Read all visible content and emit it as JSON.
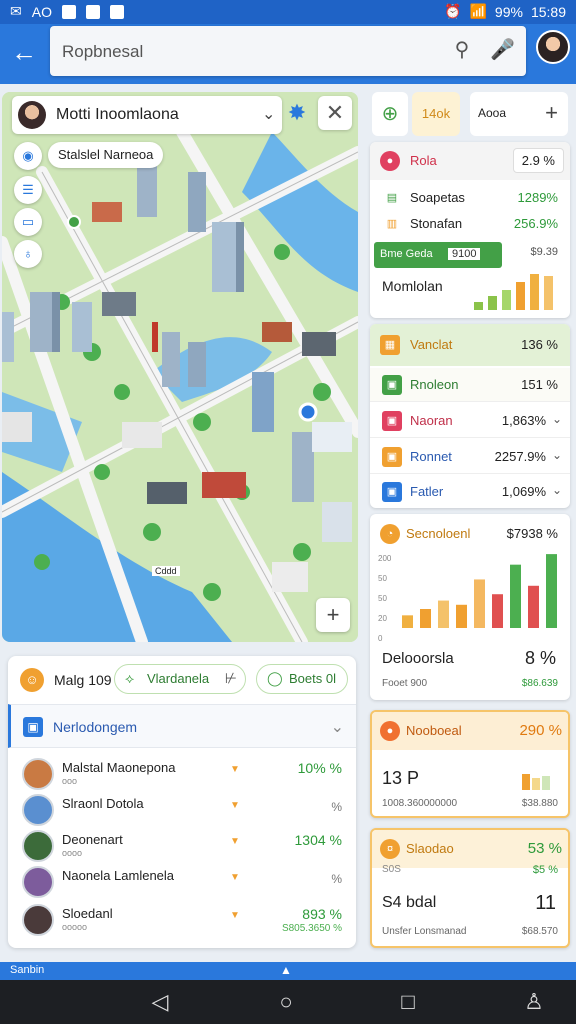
{
  "status": {
    "left_text": "AO",
    "time": "15:89",
    "battery": "99%"
  },
  "search": {
    "value": "Ropbnesal"
  },
  "map": {
    "title": "Motti Inoomlaona",
    "chip": "Stalslel Narneoa",
    "label": "Cddd"
  },
  "panel": {
    "title": "Malg 109",
    "pill1": "Vlardanela",
    "pill2": "Boets 0l",
    "section": "Nerlodongem",
    "rows": [
      {
        "name": "Malstal Maonepona",
        "sub": "ooo",
        "value": "10% %",
        "value2": "",
        "color": "#c97a43"
      },
      {
        "name": "Slraonl Dotola",
        "sub": "",
        "value": "%",
        "value2": "",
        "color": "#5a8fd0"
      },
      {
        "name": "Deonenart",
        "sub": "oooo",
        "value": "1304 %",
        "value2": "",
        "color": "#3c6b3a"
      },
      {
        "name": "Naonela Lamlenela",
        "sub": "",
        "value": "%",
        "value2": "",
        "color": "#7d5c9c"
      },
      {
        "name": "Sloedanl",
        "sub": "ooooo",
        "value": "893 %",
        "value2": "S805.3650 %",
        "color": "#4a3a3a"
      }
    ]
  },
  "right": {
    "header": {
      "chip": "14ok",
      "action": "Aooa"
    },
    "c1": {
      "title": "Rola",
      "title_val": "2.9 %",
      "r1": "Soapetas",
      "r1v": "1289%",
      "r2": "Stonafan",
      "r2v": "256.9%",
      "badge": "Bme Geda",
      "badge_num": "9100",
      "badge_right": "$9.39",
      "name": "Momlolan",
      "bars": [
        8,
        14,
        20,
        28,
        36,
        34
      ]
    },
    "c2": {
      "title": "Vanclat",
      "title_val": "136 %",
      "items": [
        {
          "label": "Rnoleon",
          "value": "151 %",
          "color": "#43a047"
        },
        {
          "label": "Naoran",
          "value": "1,863%",
          "color": "#e04060"
        },
        {
          "label": "Ronnet",
          "value": "2257.9%",
          "color": "#f0a030"
        },
        {
          "label": "Fatler",
          "value": "1,069%",
          "color": "#2a78dc"
        }
      ]
    },
    "c3": {
      "title": "Secnoloenl",
      "title_val": "$7938 %",
      "ticks": [
        "200",
        "50",
        "50",
        "20",
        "0"
      ],
      "bars": [
        {
          "v": 12,
          "c": "#f0b040"
        },
        {
          "v": 18,
          "c": "#f0a030"
        },
        {
          "v": 26,
          "c": "#f4c26a"
        },
        {
          "v": 22,
          "c": "#f0a030"
        },
        {
          "v": 46,
          "c": "#f4b860"
        },
        {
          "v": 32,
          "c": "#e05050"
        },
        {
          "v": 60,
          "c": "#4caf50"
        },
        {
          "v": 40,
          "c": "#e05050"
        },
        {
          "v": 70,
          "c": "#4caf50"
        }
      ],
      "name": "Delooorsla",
      "name_val": "8 %",
      "foot": "Fooet 900",
      "foot_val": "$86.639"
    },
    "c4": {
      "title": "Nooboeal",
      "title_val": "290 %",
      "big": "13 P",
      "foot": "1008.360000000",
      "foot_val": "$38.880"
    },
    "c5": {
      "title": "Slaodao",
      "title_val": "53 %",
      "sub": "S0S",
      "sub_val": "$5 %",
      "big": "S4 bdal",
      "big_val": "11",
      "foot": "Unsfer Lonsmanad",
      "foot_val": "$68.570"
    }
  },
  "strip": {
    "label": "Sanbin"
  }
}
